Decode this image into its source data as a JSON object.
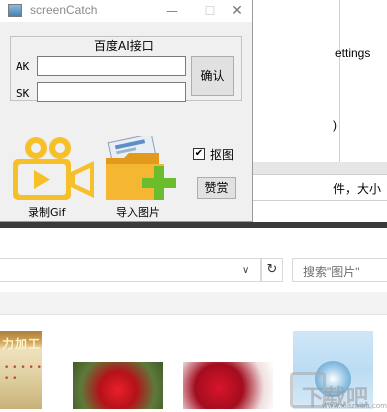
{
  "window": {
    "title": "screenCatch",
    "controls": {
      "minimize": "—",
      "maximize": "☐",
      "close": "✕"
    }
  },
  "api_group": {
    "title": "百度AI接口",
    "ak_label": "AK",
    "sk_label": "SK",
    "ak_value": "",
    "sk_value": "",
    "confirm_label": "确认"
  },
  "actions": {
    "record_gif_label": "录制Gif",
    "import_image_label": "导入图片",
    "matting_checkbox": {
      "label": "抠图",
      "checked": true,
      "mark": "✔"
    },
    "like_label": "赞赏"
  },
  "background": {
    "settings_fragment": "ettings",
    "paren_fragment": ")",
    "file_size_fragment": "件，大小",
    "refresh_glyph": "↻",
    "dropdown_glyph": "∨",
    "search_placeholder": "搜索\"图片\"",
    "thumb1_title": "力加工",
    "thumb1_text": "• • • • • • •",
    "watermark": "下载吧",
    "watermark_url": "www.xiazaiba.com"
  },
  "colors": {
    "window_bg": "#f0f0f0",
    "camera_yellow": "#f5c02a",
    "folder_orange": "#f2a826",
    "plus_green": "#6bbd2e"
  }
}
